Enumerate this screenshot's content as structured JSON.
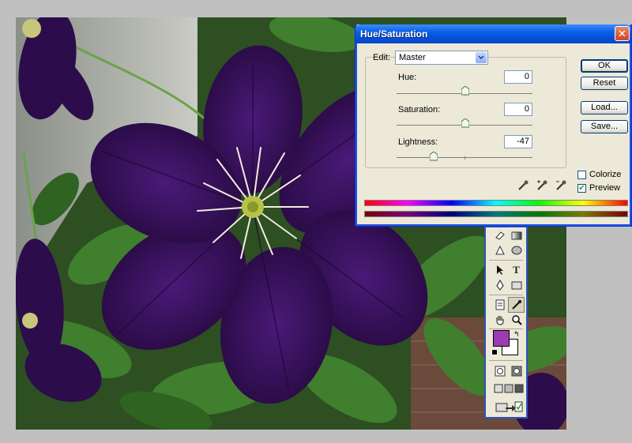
{
  "dialog": {
    "title": "Hue/Saturation",
    "close_glyph": "✕",
    "edit_label": "Edit:",
    "edit_value": "Master",
    "sliders": [
      {
        "label": "Hue:",
        "value": "0",
        "range": [
          -180,
          180
        ]
      },
      {
        "label": "Saturation:",
        "value": "0",
        "range": [
          -100,
          100
        ]
      },
      {
        "label": "Lightness:",
        "value": "-47",
        "range": [
          -100,
          100
        ]
      }
    ],
    "buttons": {
      "ok": "OK",
      "reset": "Reset",
      "load": "Load...",
      "save": "Save..."
    },
    "colorize": {
      "label": "Colorize",
      "checked": false
    },
    "preview": {
      "label": "Preview",
      "checked": true,
      "check_glyph": "✔"
    },
    "eyedroppers": [
      "eyedropper-icon",
      "eyedropper-plus-icon",
      "eyedropper-minus-icon"
    ]
  },
  "toolbox": {
    "tools": [
      "eraser-icon",
      "gradient-icon",
      "blur-icon",
      "sponge-icon",
      "path-selection-icon",
      "type-icon",
      "pen-icon",
      "rectangle-icon",
      "notes-icon",
      "eyedropper-icon",
      "hand-icon",
      "zoom-icon",
      "standard-mode-icon",
      "quick-mask-icon",
      "screen-mode-icon",
      "jump-to-imageready-icon"
    ],
    "type_glyph": "T",
    "foreground_color": "#9b3cb4",
    "background_color": "#ffffff"
  },
  "colors": {
    "accent": "#0a5fe6",
    "photo_petal": "#3d1462",
    "photo_leaf": "#3d7a2c"
  }
}
